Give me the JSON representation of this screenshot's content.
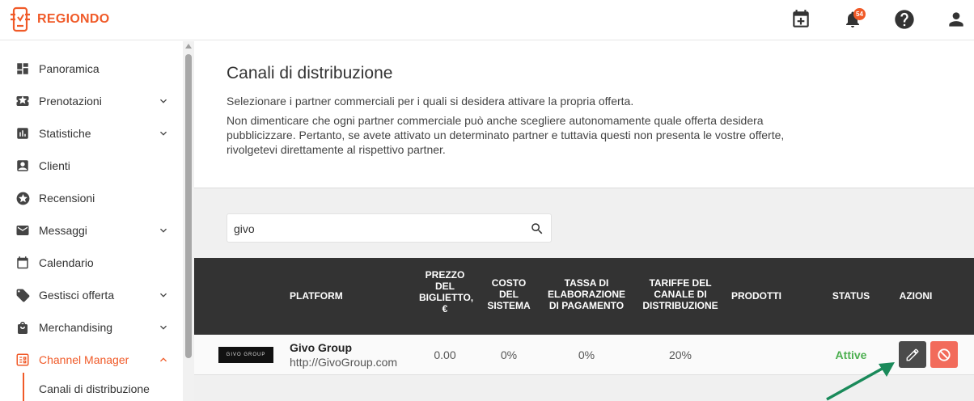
{
  "app": {
    "brand": "REGIONDO",
    "notification_count": "54"
  },
  "colors": {
    "accent": "#f05a28",
    "header_dark": "#333333",
    "status_active": "#4caf50",
    "edit_button": "#4a4a4a",
    "disable_button": "#f26b5b",
    "arrow": "#1a8a5a"
  },
  "sidebar": {
    "items": [
      {
        "label": "Panoramica",
        "icon": "dashboard-icon",
        "expandable": false
      },
      {
        "label": "Prenotazioni",
        "icon": "ticket-star-icon",
        "expandable": true
      },
      {
        "label": "Statistiche",
        "icon": "bar-chart-icon",
        "expandable": true
      },
      {
        "label": "Clienti",
        "icon": "contact-card-icon",
        "expandable": false
      },
      {
        "label": "Recensioni",
        "icon": "star-circle-icon",
        "expandable": false
      },
      {
        "label": "Messaggi",
        "icon": "envelope-icon",
        "expandable": true
      },
      {
        "label": "Calendario",
        "icon": "calendar-icon",
        "expandable": false
      },
      {
        "label": "Gestisci offerta",
        "icon": "tag-icon",
        "expandable": true
      },
      {
        "label": "Merchandising",
        "icon": "shopping-bag-icon",
        "expandable": true
      },
      {
        "label": "Channel Manager",
        "icon": "channel-icon",
        "expandable": true,
        "active": true
      }
    ],
    "sub_item": "Canali di distribuzione"
  },
  "page": {
    "title": "Canali di distribuzione",
    "intro": "Selezionare i partner commerciali per i quali si desidera attivare la propria offerta.",
    "note": "Non dimenticare che ogni partner commerciale può anche scegliere autonomamente quale offerta desidera pubblicizzare. Pertanto, se avete attivato un determinato partner e tuttavia questi non presenta le vostre offerte, rivolgetevi direttamente al rispettivo partner."
  },
  "search": {
    "value": "givo",
    "placeholder": ""
  },
  "table": {
    "headers": {
      "platform": "PLATFORM",
      "ticket_price": "PREZZO DEL BIGLIETTO, €",
      "system_cost": "COSTO DEL SISTEMA",
      "payment_fee": "TASSA DI ELABORAZIONE DI PAGAMENTO",
      "channel_fees": "TARIFFE DEL CANALE DI DISTRIBUZIONE",
      "products": "PRODOTTI",
      "status": "STATUS",
      "actions": "AZIONI"
    },
    "rows": [
      {
        "logo_text": "GIVO GROUP",
        "name": "Givo Group",
        "url": "http://GivoGroup.com",
        "ticket_price": "0.00",
        "system_cost": "0%",
        "payment_fee": "0%",
        "channel_fees": "20%",
        "products": "",
        "status": "Attive"
      }
    ]
  }
}
